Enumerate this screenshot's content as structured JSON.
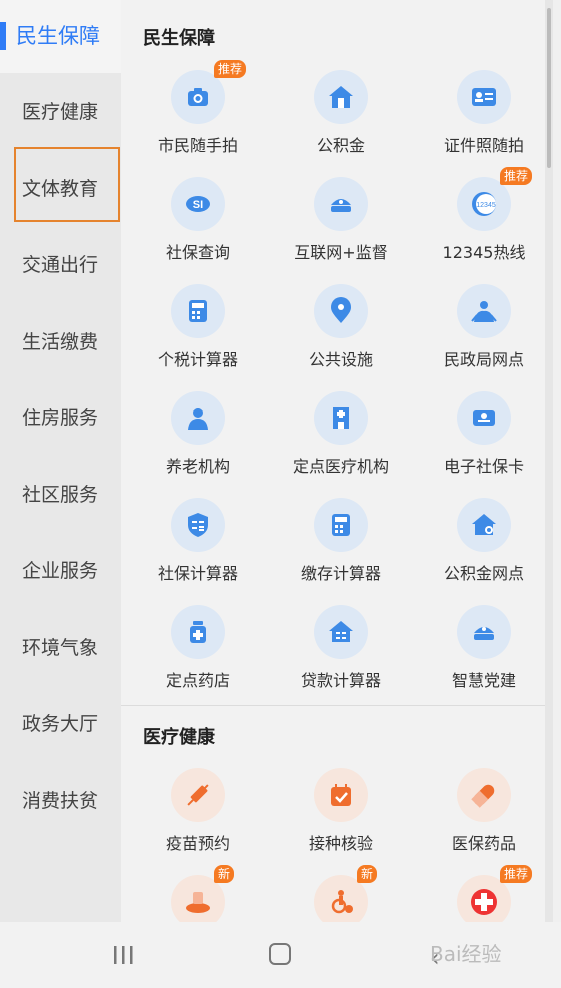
{
  "sidebar": {
    "active": "民生保障",
    "items": [
      "医疗健康",
      "文体教育",
      "交通出行",
      "生活缴费",
      "住房服务",
      "社区服务",
      "企业服务",
      "环境气象",
      "政务大厅",
      "消费扶贫"
    ]
  },
  "sections": [
    {
      "title": "民生保障",
      "items": [
        {
          "label": "市民随手拍",
          "icon": "camera-icon",
          "badge": "推荐"
        },
        {
          "label": "公积金",
          "icon": "house-icon"
        },
        {
          "label": "证件照随拍",
          "icon": "id-card-icon"
        },
        {
          "label": "社保查询",
          "icon": "social-security-icon"
        },
        {
          "label": "互联网+监督",
          "icon": "police-cap-icon"
        },
        {
          "label": "12345热线",
          "icon": "hotline-icon",
          "badge": "推荐"
        },
        {
          "label": "个税计算器",
          "icon": "calculator-icon"
        },
        {
          "label": "公共设施",
          "icon": "location-pin-icon"
        },
        {
          "label": "民政局网点",
          "icon": "civil-affairs-icon"
        },
        {
          "label": "养老机构",
          "icon": "elderly-icon"
        },
        {
          "label": "定点医疗机构",
          "icon": "hospital-building-icon"
        },
        {
          "label": "电子社保卡",
          "icon": "card-icon"
        },
        {
          "label": "社保计算器",
          "icon": "shield-calculator-icon"
        },
        {
          "label": "缴存计算器",
          "icon": "calculator-icon"
        },
        {
          "label": "公积金网点",
          "icon": "house-search-icon"
        },
        {
          "label": "定点药店",
          "icon": "medicine-bottle-icon"
        },
        {
          "label": "贷款计算器",
          "icon": "house-calculator-icon"
        },
        {
          "label": "智慧党建",
          "icon": "party-cap-icon"
        }
      ]
    },
    {
      "title": "医疗健康",
      "items": [
        {
          "label": "疫苗预约",
          "icon": "syringe-icon"
        },
        {
          "label": "接种核验",
          "icon": "calendar-check-icon"
        },
        {
          "label": "医保药品",
          "icon": "pill-icon"
        },
        {
          "label": "",
          "icon": "clinic-icon",
          "badge": "新"
        },
        {
          "label": "",
          "icon": "wheelchair-icon",
          "badge": "新"
        },
        {
          "label": "",
          "icon": "red-cross-icon",
          "badge": "推荐"
        }
      ]
    }
  ],
  "colors": {
    "accent": "#2f7cf6",
    "icon_blue": "#3d8ae6",
    "icon_orange": "#ef6d2e",
    "badge": "#f57a22",
    "highlight": "#e5832d"
  },
  "watermark": "Bai经验"
}
